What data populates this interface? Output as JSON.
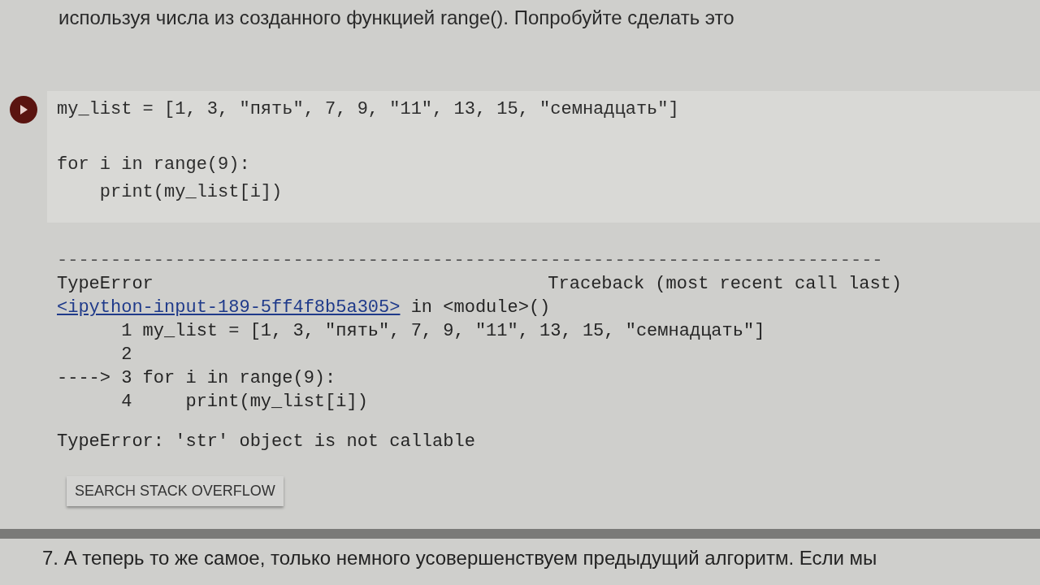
{
  "intro_text": "используя числа из созданного функцией range(). Попробуйте сделать это",
  "code_cell": {
    "blocks": [
      [
        "my_list = [1, 3, \"пять\", 7, 9, \"11\", 13, 15, \"семнадцать\"]"
      ],
      [
        "for i in range(9):",
        "    print(my_list[i])"
      ]
    ]
  },
  "output": {
    "separator": "-----------------------------------------------------------------------------",
    "header": {
      "error": "TypeError",
      "traceback": "Traceback (most recent call last)"
    },
    "location": {
      "link": "<ipython-input-189-5ff4f8b5a305>",
      "text": " in <module>()"
    },
    "trace_lines": [
      "      1 my_list = [1, 3, \"пять\", 7, 9, \"11\", 13, 15, \"семнадцать\"]",
      "      2",
      "----> 3 for i in range(9):",
      "      4     print(my_list[i])"
    ],
    "message": "TypeError: 'str' object is not callable",
    "button": "SEARCH STACK OVERFLOW"
  },
  "next_text": "7. А теперь то же самое, только немного усовершенствуем предыдущий алгоритм. Если мы"
}
